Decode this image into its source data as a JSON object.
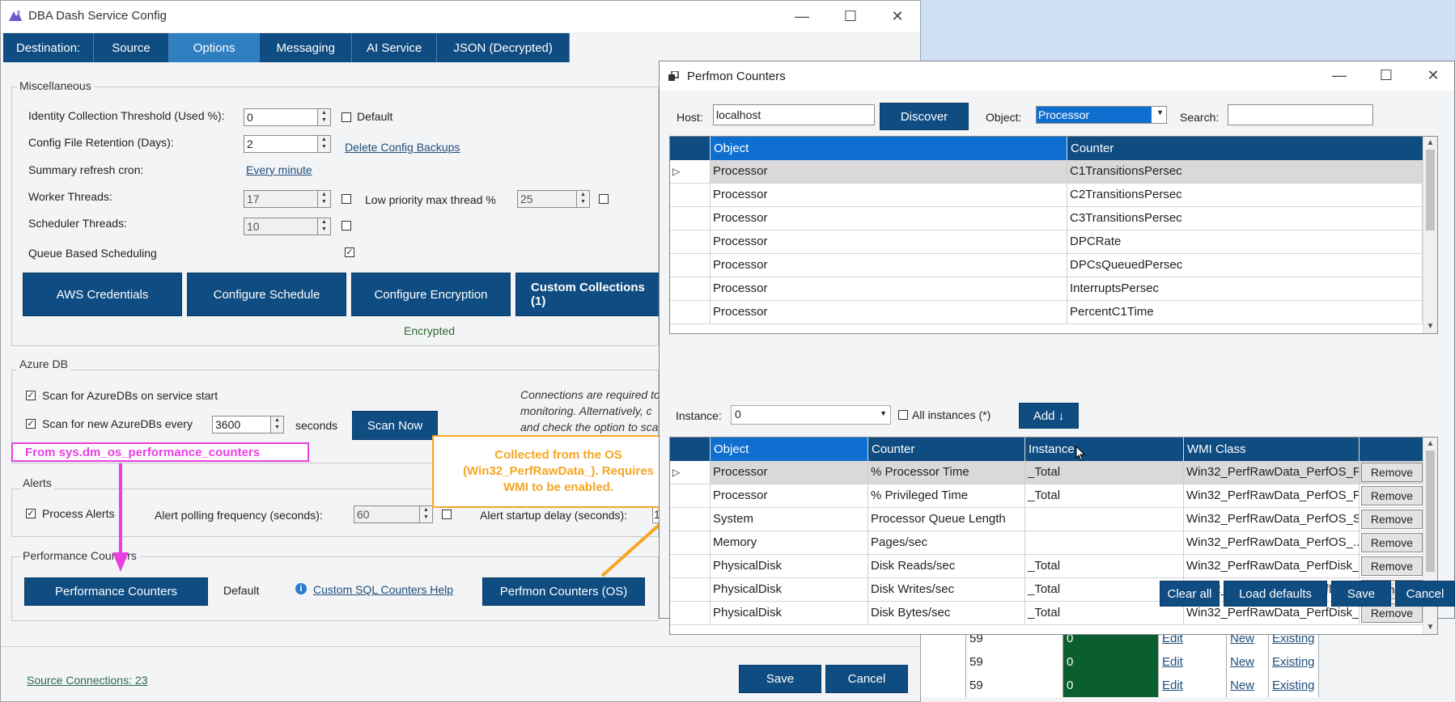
{
  "main_window": {
    "title": "DBA Dash Service Config",
    "tabs": [
      "Destination:",
      "Source",
      "Options",
      "Messaging",
      "AI Service",
      "JSON (Decrypted)"
    ],
    "active_tab": "Options",
    "misc": {
      "group_title": "Miscellaneous",
      "identity_label": "Identity Collection Threshold (Used %):",
      "identity_value": "0",
      "default_label": "Default",
      "retention_label": "Config File Retention (Days):",
      "retention_value": "2",
      "delete_backups": "Delete Config Backups",
      "summary_label": "Summary refresh cron:",
      "summary_value": "Every minute",
      "worker_label": "Worker Threads:",
      "worker_value": "17",
      "low_priority_label": "Low priority max thread %",
      "low_priority_value": "25",
      "scheduler_label": "Scheduler Threads:",
      "scheduler_value": "10",
      "queue_label": "Queue Based Scheduling",
      "buttons": [
        "AWS Credentials",
        "Configure Schedule",
        "Configure Encryption",
        "Custom Collections (1)"
      ],
      "encrypted": "Encrypted"
    },
    "azure": {
      "group_title": "Azure DB",
      "scan_start": "Scan for AzureDBs on service start",
      "scan_every": "Scan for new AzureDBs every",
      "scan_value": "3600",
      "seconds": "seconds",
      "scan_now": "Scan Now",
      "note_1": "Connections are required to",
      "note_2": "monitoring.  Alternatively, c",
      "note_3": "and check the option to sca"
    },
    "alerts": {
      "group_title": "Alerts",
      "process_alerts": "Process Alerts",
      "polling_label": "Alert polling frequency (seconds):",
      "polling_value": "60",
      "startup_label": "Alert startup delay (seconds):",
      "startup_value": "1"
    },
    "perf": {
      "group_title": "Performance Counters",
      "perf_button": "Performance Counters",
      "default_text": "Default",
      "help_link": "Custom SQL Counters Help",
      "perfmon_button": "Perfmon Counters (OS)"
    },
    "source_connections": "Source Connections: 23",
    "save": "Save",
    "cancel": "Cancel"
  },
  "annotations": {
    "pink": "From sys.dm_os_performance_counters",
    "orange_1": "Collected from the OS",
    "orange_2": "(Win32_PerfRawData_). Requires",
    "orange_3": "WMI to be enabled.",
    "pink_color": "#e840e0",
    "orange_color": "#f5a623"
  },
  "perfmon": {
    "title": "Perfmon Counters",
    "host_label": "Host:",
    "host_value": "localhost",
    "discover": "Discover",
    "object_label": "Object:",
    "object_value": "Processor",
    "search_label": "Search:",
    "search_value": "",
    "top_grid": {
      "headers": [
        "Object",
        "Counter"
      ],
      "rows": [
        [
          "Processor",
          "C1TransitionsPersec"
        ],
        [
          "Processor",
          "C2TransitionsPersec"
        ],
        [
          "Processor",
          "C3TransitionsPersec"
        ],
        [
          "Processor",
          "DPCRate"
        ],
        [
          "Processor",
          "DPCsQueuedPersec"
        ],
        [
          "Processor",
          "InterruptsPersec"
        ],
        [
          "Processor",
          "PercentC1Time"
        ]
      ]
    },
    "instance_label": "Instance:",
    "instance_value": "0",
    "all_instances": "All instances (*)",
    "add": "Add ↓",
    "bottom_grid": {
      "headers": [
        "Object",
        "Counter",
        "Instance",
        "WMI Class"
      ],
      "remove": "Remove",
      "rows": [
        [
          "Processor",
          "% Processor Time",
          "_Total",
          "Win32_PerfRawData_PerfOS_P..."
        ],
        [
          "Processor",
          "% Privileged Time",
          "_Total",
          "Win32_PerfRawData_PerfOS_P..."
        ],
        [
          "System",
          "Processor Queue Length",
          "",
          "Win32_PerfRawData_PerfOS_S..."
        ],
        [
          "Memory",
          "Pages/sec",
          "",
          "Win32_PerfRawData_PerfOS_..."
        ],
        [
          "PhysicalDisk",
          "Disk Reads/sec",
          "_Total",
          "Win32_PerfRawData_PerfDisk_..."
        ],
        [
          "PhysicalDisk",
          "Disk Writes/sec",
          "_Total",
          "Win32_PerfRawData_PerfDisk_..."
        ],
        [
          "PhysicalDisk",
          "Disk Bytes/sec",
          "_Total",
          "Win32_PerfRawData_PerfDisk_..."
        ]
      ]
    },
    "clear_all": "Clear all",
    "load_defaults": "Load defaults",
    "save": "Save",
    "cancel": "Cancel"
  },
  "background_grid": {
    "rows": [
      [
        "59",
        "0",
        "Edit",
        "New",
        "Existing"
      ],
      [
        "59",
        "0",
        "Edit",
        "New",
        "Existing"
      ],
      [
        "59",
        "0",
        "Edit",
        "New",
        "Existing"
      ]
    ],
    "green": "#0b5e2e"
  }
}
